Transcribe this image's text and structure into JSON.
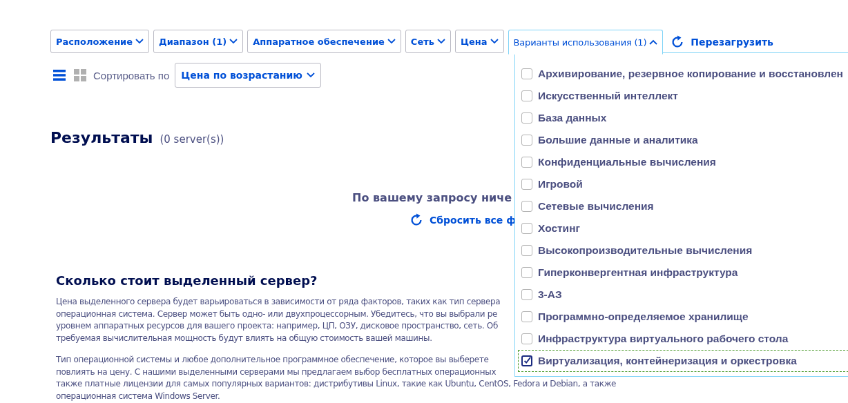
{
  "filters": [
    {
      "label": "Расположение",
      "open": false
    },
    {
      "label": "Диапазон (1)",
      "open": false
    },
    {
      "label": "Аппаратное обеспечение",
      "open": false
    },
    {
      "label": "Сеть",
      "open": false
    },
    {
      "label": "Цена",
      "open": false
    },
    {
      "label": "Варианты использования (1)",
      "open": true
    }
  ],
  "reload": {
    "label": "Перезагрузить"
  },
  "view": {
    "list_selected": true
  },
  "sort": {
    "label": "Сортировать по",
    "value": "Цена по возрастанию"
  },
  "results": {
    "title": "Результаты",
    "count": "(0 server(s))"
  },
  "empty": {
    "message": "По вашему запросу ниче",
    "reset": "Сбросить все ф"
  },
  "article": {
    "title": "Сколько стоит выделенный сервер?",
    "paragraphs": [
      [
        "Цена выделенного сервера будет варьироваться в зависимости от ряда факторов, таких как тип сервера",
        "операционная система. Сервер может быть одно- или двухпроцессорным. Убедитесь, что вы выбрали ре",
        "уровнем аппаратных ресурсов для вашего проекта: например, ЦП, ОЗУ, дисковое пространство, сеть. Об",
        "требуемая вычислительная мощность будут влиять на общую стоимость вашей машины."
      ],
      [
        "Тип операционной системы и любое дополнительное программное обеспечение, которое вы выберете",
        "повлиять на цену. С нашими выделенными серверами мы предлагаем выбор бесплатных операционных",
        "также платные лицензии для самых популярных вариантов: дистрибутивы Linux, такие как Ubuntu, CentOS, Fedora и Debian, а также",
        "операционная система Windows Server."
      ]
    ]
  },
  "use_cases": [
    {
      "label": "Архивирование, резервное копирование и восстановлен",
      "checked": false,
      "focused": false
    },
    {
      "label": "Искусственный интеллект",
      "checked": false,
      "focused": false
    },
    {
      "label": "База данных",
      "checked": false,
      "focused": false
    },
    {
      "label": "Большие данные и аналитика",
      "checked": false,
      "focused": false
    },
    {
      "label": "Конфиденциальные вычисления",
      "checked": false,
      "focused": false
    },
    {
      "label": "Игровой",
      "checked": false,
      "focused": false
    },
    {
      "label": "Сетевые вычисления",
      "checked": false,
      "focused": false
    },
    {
      "label": "Хостинг",
      "checked": false,
      "focused": false
    },
    {
      "label": "Высокопроизводительные вычисления",
      "checked": false,
      "focused": false
    },
    {
      "label": "Гиперконвергентная инфраструктура",
      "checked": false,
      "focused": false
    },
    {
      "label": "3-АЗ",
      "checked": false,
      "focused": false
    },
    {
      "label": "Программно-определяемое хранилище",
      "checked": false,
      "focused": false
    },
    {
      "label": "Инфраструктура виртуального рабочего стола",
      "checked": false,
      "focused": false
    },
    {
      "label": "Виртуализация, контейнеризация и оркестровка",
      "checked": true,
      "focused": true
    }
  ]
}
